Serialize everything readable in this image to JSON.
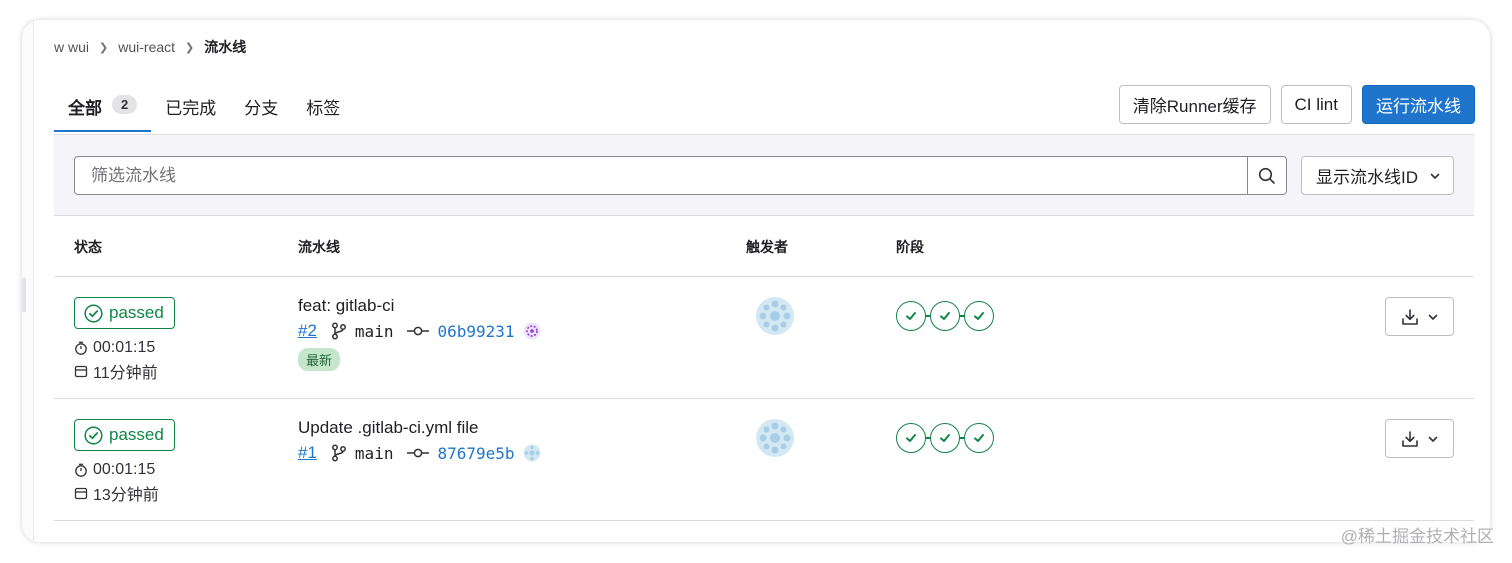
{
  "breadcrumb": {
    "group": "w wui",
    "project": "wui-react",
    "current": "流水线"
  },
  "tabs": [
    {
      "label": "全部",
      "count": "2"
    },
    {
      "label": "已完成"
    },
    {
      "label": "分支"
    },
    {
      "label": "标签"
    }
  ],
  "actions": {
    "clear_cache": "清除Runner缓存",
    "ci_lint": "CI lint",
    "run_pipeline": "运行流水线"
  },
  "filter": {
    "placeholder": "筛选流水线",
    "display_select": "显示流水线ID"
  },
  "table": {
    "headers": {
      "status": "状态",
      "pipeline": "流水线",
      "triggerer": "触发者",
      "stages": "阶段"
    },
    "rows": [
      {
        "status": "passed",
        "duration": "00:01:15",
        "finished": "11分钟前",
        "title": "feat: gitlab-ci",
        "id": "#2",
        "branch": "main",
        "commit": "06b99231",
        "badge": "最新"
      },
      {
        "status": "passed",
        "duration": "00:01:15",
        "finished": "13分钟前",
        "title": "Update .gitlab-ci.yml file",
        "id": "#1",
        "branch": "main",
        "commit": "87679e5b"
      }
    ]
  },
  "colors": {
    "accent": "#1f75cb",
    "success": "#108548"
  },
  "watermark": "@稀土掘金技术社区"
}
